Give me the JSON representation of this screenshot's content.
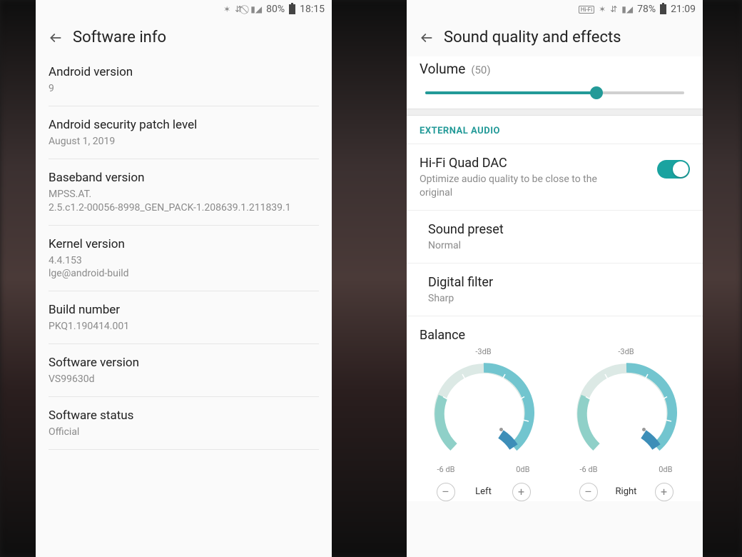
{
  "left": {
    "status": {
      "battery": "80%",
      "time": "18:15"
    },
    "title": "Software info",
    "rows": [
      {
        "t": "Android version",
        "s": "9"
      },
      {
        "t": "Android security patch level",
        "s": "August 1, 2019"
      },
      {
        "t": "Baseband version",
        "s": "MPSS.AT.\n2.5.c1.2-00056-8998_GEN_PACK-1.208639.1.211839.1"
      },
      {
        "t": "Kernel version",
        "s": "4.4.153\nlge@android-build"
      },
      {
        "t": "Build number",
        "s": "PKQ1.190414.001"
      },
      {
        "t": "Software version",
        "s": "VS99630d"
      },
      {
        "t": "Software status",
        "s": "Official"
      }
    ]
  },
  "right": {
    "status": {
      "hifi": "Hi-Fi",
      "battery": "78%",
      "time": "21:09"
    },
    "title": "Sound quality and effects",
    "volume": {
      "label": "Volume",
      "value": "(50)",
      "percent": 66
    },
    "section_header": "EXTERNAL AUDIO",
    "dac": {
      "title": "Hi-Fi Quad DAC",
      "sub": "Optimize audio quality to be close to the original",
      "on": true
    },
    "preset": {
      "title": "Sound preset",
      "sub": "Normal"
    },
    "filter": {
      "title": "Digital filter",
      "sub": "Sharp"
    },
    "balance": {
      "title": "Balance",
      "top_db": "-3dB",
      "left_db": "-6 dB",
      "right_db": "0dB",
      "dials": [
        {
          "side": "Left"
        },
        {
          "side": "Right"
        }
      ],
      "minus": "–",
      "plus": "+"
    }
  }
}
